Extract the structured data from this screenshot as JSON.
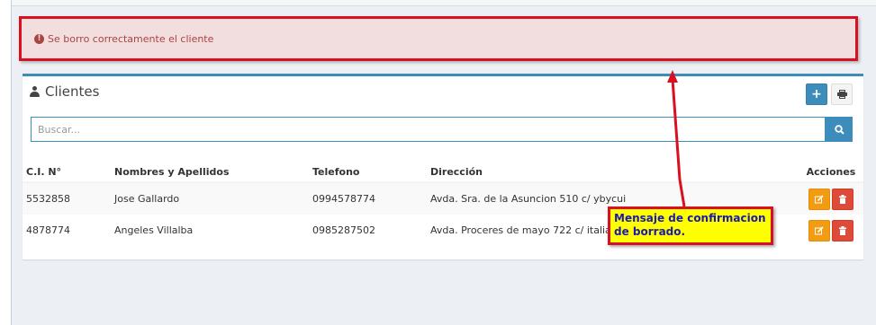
{
  "alert": {
    "message": "Se borro correctamente el cliente",
    "icon": "exclamation-circle-icon"
  },
  "box": {
    "title": "Clientes",
    "title_icon": "user-icon"
  },
  "toolbar": {
    "add_label": "+",
    "print_icon": "printer-icon"
  },
  "search": {
    "placeholder": "Buscar...",
    "value": "",
    "button_icon": "search-icon"
  },
  "table": {
    "columns": [
      "C.I. N°",
      "Nombres y Apellidos",
      "Telefono",
      "Dirección",
      "Acciones"
    ],
    "rows": [
      {
        "ci": "5532858",
        "name": "Jose Gallardo",
        "phone": "0994578774",
        "address": "Avda. Sra. de la Asuncion 510 c/ ybycui"
      },
      {
        "ci": "4878774",
        "name": "Angeles Villalba",
        "phone": "0985287502",
        "address": "Avda. Proceres de mayo 722 c/ italia"
      }
    ]
  },
  "annotation": {
    "line1": "Mensaje de confirmacion",
    "line2": "de borrado."
  },
  "colors": {
    "primary": "#3c8dbc",
    "warning": "#f39c12",
    "danger": "#dd4b39",
    "alert_bg": "#f2dede",
    "alert_text": "#a94442",
    "callout_bg": "#ffff00",
    "annotation_red": "#d9101f"
  }
}
